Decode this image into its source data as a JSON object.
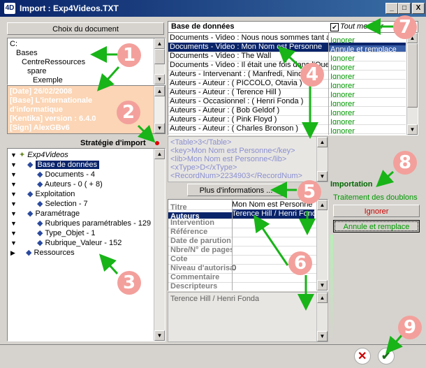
{
  "window": {
    "logo": "4D",
    "title": "Import : Exp4Videos.TXT",
    "min": "_",
    "max": "□",
    "close": "X"
  },
  "left": {
    "choose_button": "Choix du document",
    "path": [
      "C:",
      "Bases",
      "CentreRessources",
      "spare",
      "Exemple"
    ],
    "info": [
      "[Date] 26/02/2008",
      "[Base] L'internationale",
      "d'informatique",
      "[Kentika] version : 6.4.0",
      "[Sign] AlexGBv6"
    ],
    "strategy_label": "Stratégie d'import",
    "tree": [
      {
        "label": "Exp4Videos",
        "italic": true
      },
      {
        "label": "Base de données",
        "selected": true
      },
      {
        "label": "Documents - 4"
      },
      {
        "label": "Auteurs - 0 ( + 8)"
      },
      {
        "label": "Exploitation"
      },
      {
        "label": "Selection - 7"
      },
      {
        "label": "Paramétrage"
      },
      {
        "label": "Rubriques paramétrables - 129"
      },
      {
        "label": "Type_Objet - 1"
      },
      {
        "label": "Rubrique_Valeur - 152"
      },
      {
        "label": "Ressources"
      }
    ]
  },
  "db": {
    "header": "Base de données",
    "show_all_label": "Tout montrer",
    "rows": [
      {
        "name": "Documents - Video : Nous nous sommes tant aim",
        "action": "Ignorer"
      },
      {
        "name": "Documents - Video : Mon Nom est Personne",
        "action": "Annule et remplace",
        "selected": true
      },
      {
        "name": "Documents - Video : The Wall",
        "action": "Ignorer"
      },
      {
        "name": "Documents - Video : Il était une fois dans l'Ouest",
        "action": "Ignorer"
      },
      {
        "name": "Auteurs - Intervenant : ( Manfredi, Nino )",
        "action": "Ignorer"
      },
      {
        "name": "Auteurs - Auteur : ( PICCOLO, Otavia )",
        "action": "Ignorer"
      },
      {
        "name": "Auteurs - Auteur : ( Terence Hill )",
        "action": "Ignorer"
      },
      {
        "name": "Auteurs - Occasionnel : ( Henri Fonda )",
        "action": "Ignorer"
      },
      {
        "name": "Auteurs - Auteur : ( Bob Geldof )",
        "action": "Ignorer"
      },
      {
        "name": "Auteurs - Auteur : ( Pink Floyd )",
        "action": "Ignorer"
      },
      {
        "name": "Auteurs - Auteur : ( Charles Bronson )",
        "action": "Ignorer"
      }
    ]
  },
  "xml": [
    "<Table>3</Table>",
    "<key>Mon Nom est Personne</key>",
    "<lib>Mon Nom est Personne</lib>",
    "<xType>D</xType>",
    "<RecordNum>2234903</RecordNum>"
  ],
  "more_info_button": "Plus d'informations ...",
  "fields": [
    {
      "label": "Titre",
      "value": "Mon Nom est Personne"
    },
    {
      "label": "Auteurs",
      "value": "Terence Hill / Henri Fonda",
      "selected": true
    },
    {
      "label": "Intervention",
      "value": ""
    },
    {
      "label": "Référence",
      "value": ""
    },
    {
      "label": "Date de parution",
      "value": ""
    },
    {
      "label": "Nbre/N° de pages",
      "value": ""
    },
    {
      "label": "Cote",
      "value": ""
    },
    {
      "label": "Niveau d'autorisation",
      "value": "0"
    },
    {
      "label": "Commentaire",
      "value": ""
    },
    {
      "label": "Descripteurs",
      "value": ""
    }
  ],
  "field_detail": "Terence Hill / Henri Fonda",
  "import_panel": {
    "title": "Importation",
    "subtitle": "Traitement des doublons",
    "ignore_button": "Ignorer",
    "replace_button": "Annule et remplace"
  },
  "badges": [
    "1",
    "2",
    "3",
    "4",
    "5",
    "6",
    "7",
    "8",
    "9"
  ],
  "footer": {
    "cancel_icon": "cancel-icon",
    "ok_icon": "ok-icon"
  },
  "colors": {
    "accent_green": "#009900",
    "badge": "#f3a09c",
    "info_bg": "#fbd5b5",
    "title_bar": "#0a246a"
  }
}
